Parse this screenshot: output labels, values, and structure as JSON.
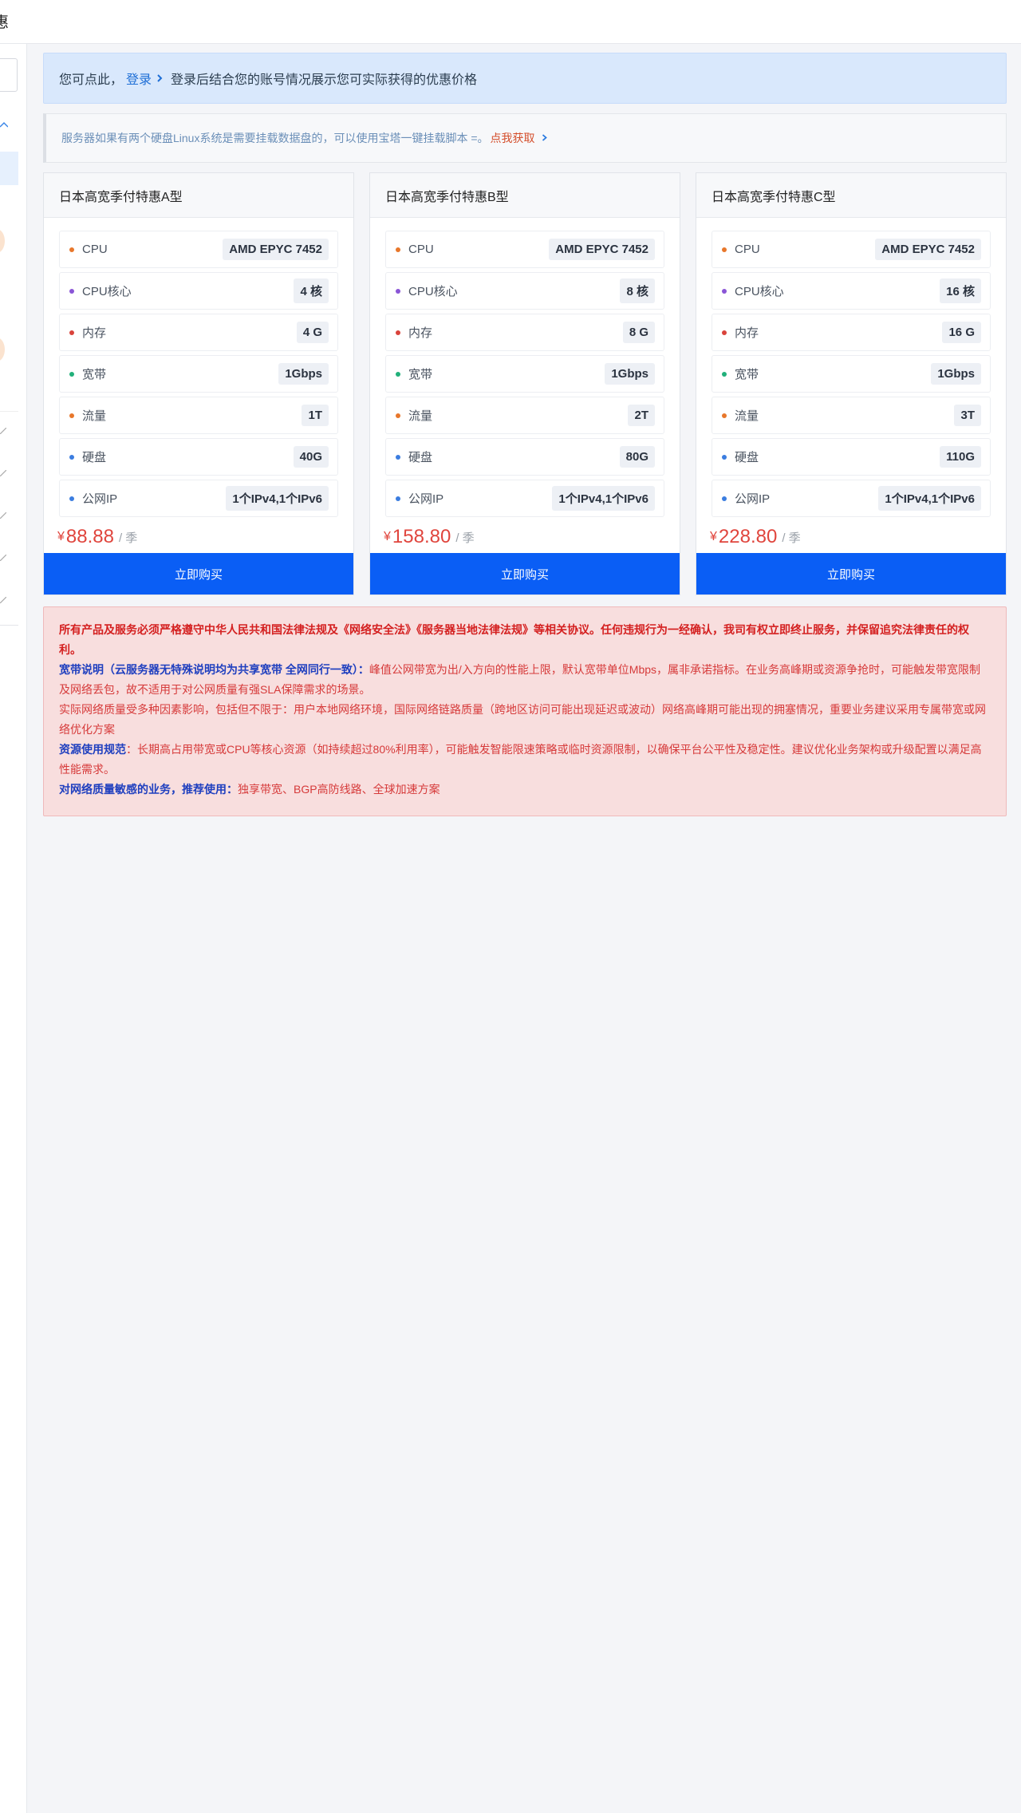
{
  "topbar": {
    "title": "惠"
  },
  "banner": {
    "prefix": "您可点此，",
    "login_link": "登录",
    "suffix": "登录后结合您的账号情况展示您可实际获得的优惠价格"
  },
  "notice": {
    "text": "服务器如果有两个硬盘Linux系统是需要挂载数据盘的，可以使用宝塔一键挂载脚本 =。",
    "link": "点我获取"
  },
  "colors": {
    "dot_orange": "#e8772b",
    "dot_purple": "#8a55d6",
    "dot_red": "#d9433b",
    "dot_green": "#21b07a",
    "dot_blue": "#3b7de0",
    "buy_button": "#0a5ef5",
    "price": "#e0453d"
  },
  "cards": [
    {
      "title": "日本高宽季付特惠A型",
      "specs": [
        {
          "label": "CPU",
          "value": "AMD EPYC 7452"
        },
        {
          "label": "CPU核心",
          "value": "4 核"
        },
        {
          "label": "内存",
          "value": "4 G"
        },
        {
          "label": "宽带",
          "value": "1Gbps"
        },
        {
          "label": "流量",
          "value": "1T"
        },
        {
          "label": "硬盘",
          "value": "40G"
        },
        {
          "label": "公网IP",
          "value": "1个IPv4,1个IPv6"
        }
      ],
      "currency": "¥",
      "price": "88.88",
      "period": "/ 季",
      "buy_label": "立即购买"
    },
    {
      "title": "日本高宽季付特惠B型",
      "specs": [
        {
          "label": "CPU",
          "value": "AMD EPYC 7452"
        },
        {
          "label": "CPU核心",
          "value": "8 核"
        },
        {
          "label": "内存",
          "value": "8 G"
        },
        {
          "label": "宽带",
          "value": "1Gbps"
        },
        {
          "label": "流量",
          "value": "2T"
        },
        {
          "label": "硬盘",
          "value": "80G"
        },
        {
          "label": "公网IP",
          "value": "1个IPv4,1个IPv6"
        }
      ],
      "currency": "¥",
      "price": "158.80",
      "period": "/ 季",
      "buy_label": "立即购买"
    },
    {
      "title": "日本高宽季付特惠C型",
      "specs": [
        {
          "label": "CPU",
          "value": "AMD EPYC 7452"
        },
        {
          "label": "CPU核心",
          "value": "16 核"
        },
        {
          "label": "内存",
          "value": "16 G"
        },
        {
          "label": "宽带",
          "value": "1Gbps"
        },
        {
          "label": "流量",
          "value": "3T"
        },
        {
          "label": "硬盘",
          "value": "110G"
        },
        {
          "label": "公网IP",
          "value": "1个IPv4,1个IPv6"
        }
      ],
      "currency": "¥",
      "price": "228.80",
      "period": "/ 季",
      "buy_label": "立即购买"
    }
  ],
  "legal": {
    "p1": "所有产品及服务必须严格遵守中华人民共和国法律法规及《网络安全法》《服务器当地法律法规》等相关协议。任何违规行为一经确认，我司有权立即终止服务，并保留追究法律责任的权利。",
    "p2_bold": "宽带说明（云服务器无特殊说明均为共享宽带 全网同行一致）：",
    "p2_text": "峰值公网带宽为出/入方向的性能上限，默认宽带单位Mbps，属非承诺指标。在业务高峰期或资源争抢时，可能触发带宽限制及网络丢包，故不适用于对公网质量有强SLA保障需求的场景。",
    "p3": "实际网络质量受多种因素影响，包括但不限于：用户本地网络环境，国际网络链路质量（跨地区访问可能出现延迟或波动）网络高峰期可能出现的拥塞情况，重要业务建议采用专属带宽或网络优化方案",
    "p4_bold": "资源使用规范",
    "p4_text": "：长期高占用带宽或CPU等核心资源（如持续超过80%利用率），可能触发智能限速策略或临时资源限制，以确保平台公平性及稳定性。建议优化业务架构或升级配置以满足高性能需求。",
    "p5_bold": "对网络质量敏感的业务，推荐使用：",
    "p5_text": "独享带宽、BGP高防线路、全球加速方案"
  }
}
